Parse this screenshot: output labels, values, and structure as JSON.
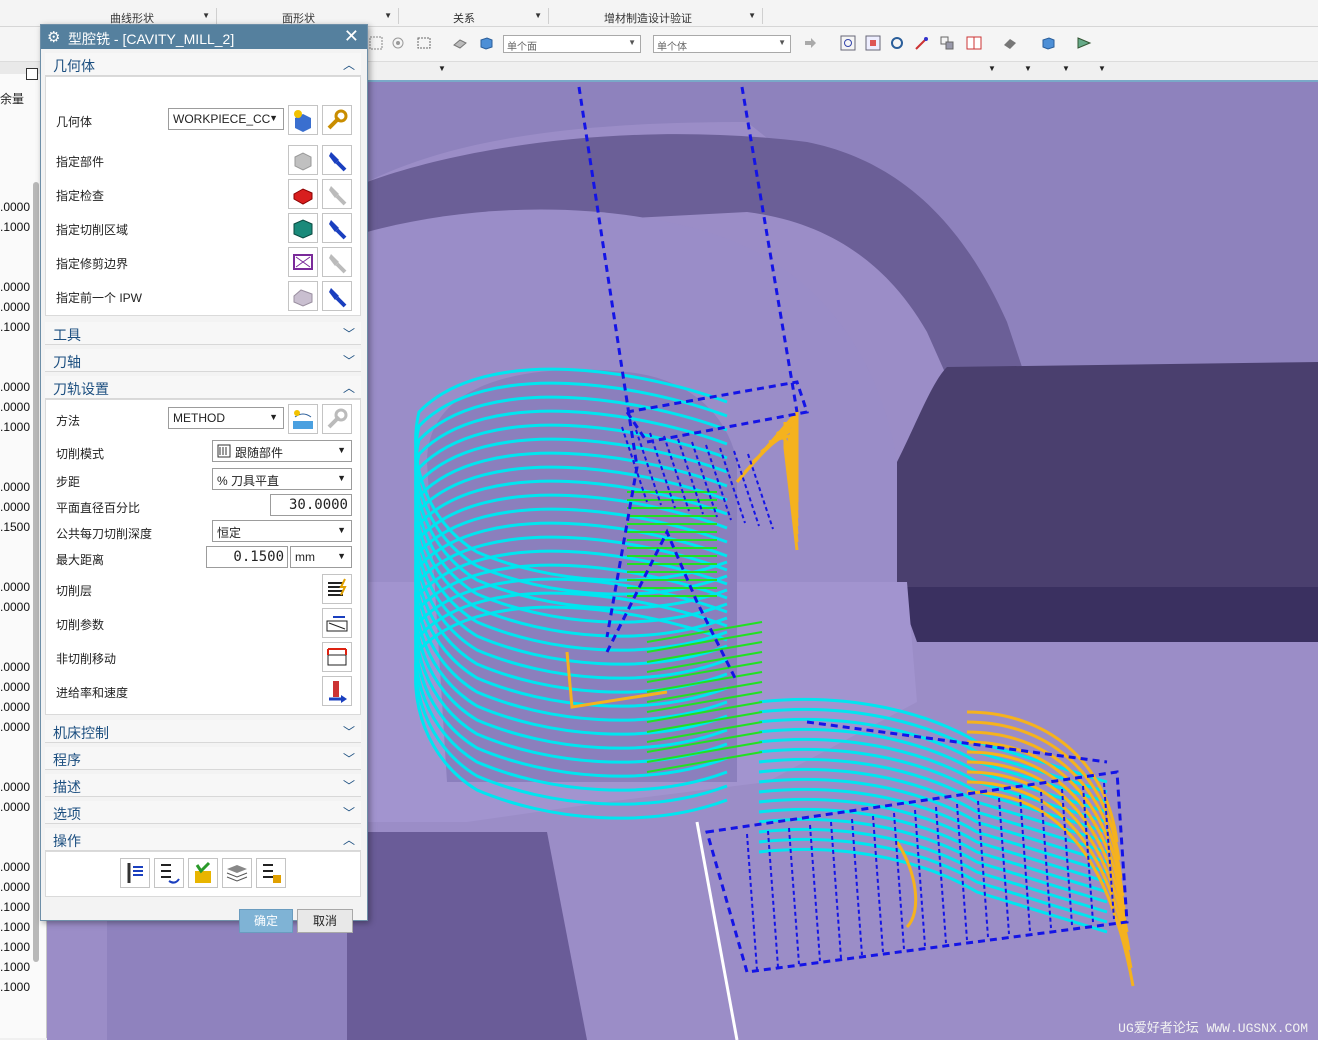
{
  "ribbon": {
    "groups": [
      "曲线形状",
      "面形状",
      "关系",
      "增材制造设计验证"
    ]
  },
  "toolbar": {
    "face_filter": "单个面",
    "body_filter": "单个体"
  },
  "left_strip": {
    "header": "余量",
    "values": [
      ".0000",
      ".1000",
      ".0000",
      ".0000",
      ".1000",
      ".0000",
      ".0000",
      ".1000",
      ".0000",
      ".0000",
      ".1500",
      ".0000",
      ".0000",
      ".0000",
      ".0000",
      ".0000",
      ".0000",
      ".0000",
      ".0000",
      ".0000",
      ".0000",
      ".1000",
      ".1000",
      ".1000",
      ".1000",
      ".1000"
    ]
  },
  "dialog": {
    "title": "型腔铣 - [CAVITY_MILL_2]",
    "geometry": {
      "section": "几何体",
      "geometry_label": "几何体",
      "geometry_value": "WORKPIECE_CC",
      "rows": [
        "指定部件",
        "指定检查",
        "指定切削区域",
        "指定修剪边界",
        "指定前一个 IPW"
      ]
    },
    "collapsed_1": [
      "工具",
      "刀轴"
    ],
    "path_settings": {
      "section": "刀轨设置",
      "method_label": "方法",
      "method_value": "METHOD",
      "cut_pattern_label": "切削模式",
      "cut_pattern_value": "跟随部件",
      "stepover_label": "步距",
      "stepover_value": "% 刀具平直",
      "percent_label": "平面直径百分比",
      "percent_value": "30.0000",
      "depth_label": "公共每刀切削深度",
      "depth_value": "恒定",
      "max_dist_label": "最大距离",
      "max_dist_value": "0.1500",
      "unit_value": "mm",
      "cut_levels_label": "切削层",
      "cut_params_label": "切削参数",
      "non_cut_label": "非切削移动",
      "feeds_label": "进给率和速度"
    },
    "collapsed_2": [
      "机床控制",
      "程序",
      "描述",
      "选项"
    ],
    "actions_section": "操作",
    "ok_label": "确定",
    "cancel_label": "取消"
  },
  "viewport": {
    "watermark": "UG爱好者论坛 WWW.UGSNX.COM"
  },
  "colors": {
    "viewport_bg": "#9b8dc7",
    "toolpath_cyan": "#00e5f0",
    "toolpath_orange": "#f5b21e",
    "toolpath_green": "#22e022",
    "toolpath_blue": "#1414e6",
    "title_bar": "#55809e"
  }
}
